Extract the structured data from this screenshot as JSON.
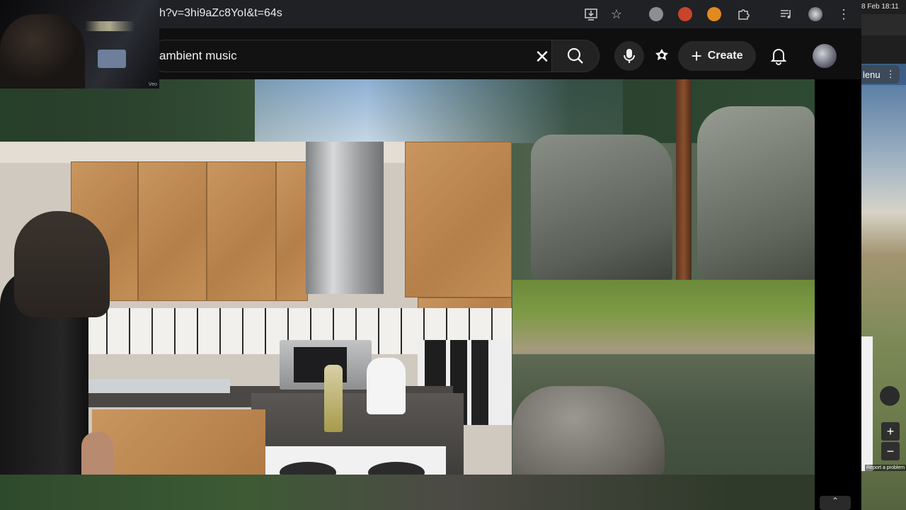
{
  "browser": {
    "url": "h?v=3hi9aZc8YoI&t=64s",
    "icons": [
      "download-icon",
      "star-icon",
      "extension-owl-icon",
      "extension-red-icon",
      "extension-orange-icon",
      "puzzle-icon",
      "media-control-icon",
      "profile-icon",
      "more-vert-icon"
    ]
  },
  "youtube": {
    "search_value": "ambient music",
    "create_label": "Create",
    "icons": [
      "clear-icon",
      "search-icon",
      "mic-icon",
      "gemini-icon",
      "plus-icon",
      "bell-icon",
      "avatar"
    ]
  },
  "overlays": {
    "webcam_tag": "Veo"
  },
  "side_window": {
    "clock": "8 Feb  18:11",
    "menu_label": "lenu",
    "report_label": "Report a problem",
    "zoom_in": "+",
    "zoom_out": "−"
  },
  "colors": {
    "chrome_bg": "#202124",
    "yt_bg": "#0f0f0f",
    "button_bg": "#272727"
  }
}
